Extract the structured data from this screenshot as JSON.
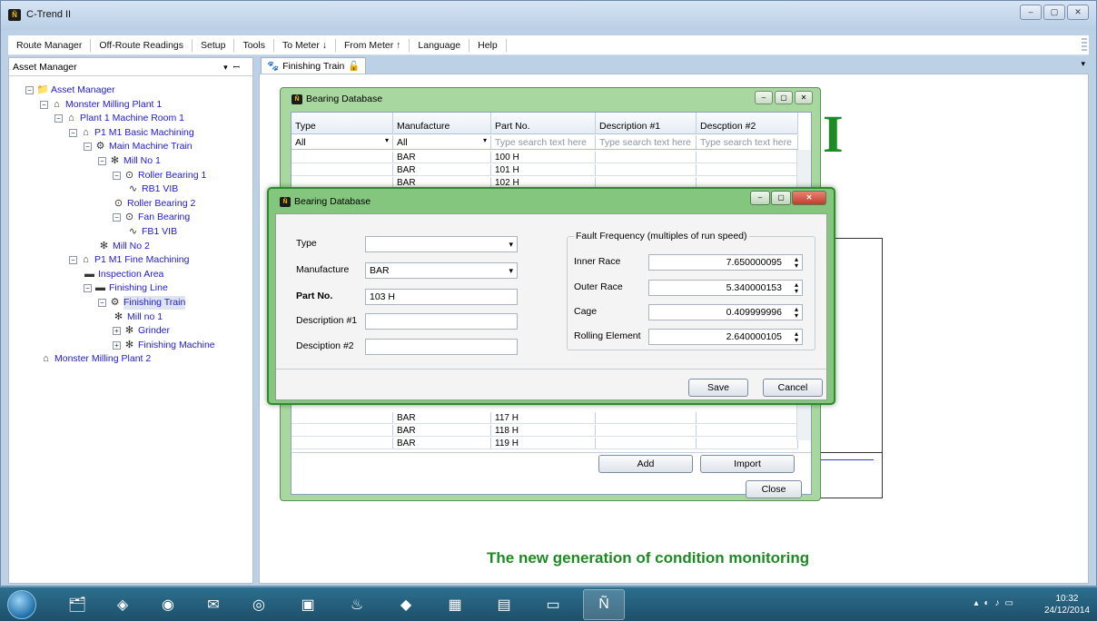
{
  "window": {
    "title": "C-Trend II",
    "controls": [
      "–",
      "▢",
      "✕"
    ]
  },
  "menu": [
    "Route Manager",
    "Off-Route Readings",
    "Setup",
    "Tools",
    "To Meter ↓",
    "From Meter ↑",
    "Language",
    "Help"
  ],
  "asset_manager": {
    "header": "Asset Manager",
    "tree": [
      {
        "label": "Asset Manager",
        "icon": "folder-icon",
        "exp": "−"
      },
      {
        "label": "Monster Milling Plant 1",
        "icon": "plant-icon",
        "exp": "−"
      },
      {
        "label": "Plant 1 Machine Room 1",
        "icon": "plant-icon",
        "exp": "−"
      },
      {
        "label": "P1 M1 Basic Machining",
        "icon": "area-icon",
        "exp": "−"
      },
      {
        "label": "Main Machine Train",
        "icon": "train-icon",
        "exp": "−"
      },
      {
        "label": "Mill No 1",
        "icon": "machine-icon",
        "exp": "−"
      },
      {
        "label": "Roller Bearing 1",
        "icon": "bearing-icon",
        "exp": "−"
      },
      {
        "label": "RB1 VIB",
        "icon": "vibration-icon",
        "exp": ""
      },
      {
        "label": "Roller Bearing 2",
        "icon": "bearing-icon",
        "exp": ""
      },
      {
        "label": "Fan Bearing",
        "icon": "bearing-icon",
        "exp": "−"
      },
      {
        "label": "FB1 VIB",
        "icon": "vibration-icon",
        "exp": ""
      },
      {
        "label": "Mill No 2",
        "icon": "machine-icon",
        "exp": ""
      },
      {
        "label": "P1 M1 Fine Machining",
        "icon": "area-icon",
        "exp": "−"
      },
      {
        "label": "Inspection Area",
        "icon": "line-icon",
        "exp": ""
      },
      {
        "label": "Finishing Line",
        "icon": "line-icon",
        "exp": "−"
      },
      {
        "label": "Finishing Train",
        "icon": "train-icon",
        "exp": "−"
      },
      {
        "label": "Mill no 1",
        "icon": "machine-icon",
        "exp": ""
      },
      {
        "label": "Grinder",
        "icon": "machine-icon",
        "exp": "+"
      },
      {
        "label": "Finishing Machine",
        "icon": "machine-icon",
        "exp": "+"
      },
      {
        "label": "Monster Milling Plant 2",
        "icon": "plant-icon",
        "exp": ""
      }
    ]
  },
  "document_tab": {
    "label": "Finishing Train"
  },
  "tagline": "The new generation of condition monitoring",
  "logo_letter": "I",
  "bearing_db": {
    "title": "Bearing Database",
    "columns": [
      "Type",
      "Manufacture",
      "Part No.",
      "Description #1",
      "Descption #2"
    ],
    "filters": [
      "All",
      "All",
      "Type search text here",
      "Type search text here",
      "Type search text here"
    ],
    "rows_top": [
      [
        "",
        "BAR",
        "100 H",
        "",
        ""
      ],
      [
        "",
        "BAR",
        "101 H",
        "",
        ""
      ],
      [
        "",
        "BAR",
        "102 H",
        "",
        ""
      ]
    ],
    "rows_bottom": [
      [
        "",
        "BAR",
        "117 H",
        "",
        ""
      ],
      [
        "",
        "BAR",
        "118 H",
        "",
        ""
      ],
      [
        "",
        "BAR",
        "119 H",
        "",
        ""
      ]
    ],
    "buttons": {
      "add": "Add",
      "import": "Import",
      "close": "Close"
    }
  },
  "dialog": {
    "title": "Bearing Database",
    "type_label": "Type",
    "type_value": "",
    "manufacture_label": "Manufacture",
    "manufacture_value": "BAR",
    "part_label": "Part No.",
    "part_value": "103 H",
    "desc1_label": "Description #1",
    "desc1_value": "",
    "desc2_label": "Desciption #2",
    "desc2_value": "",
    "ff_title": "Fault Frequency (multiples of run speed)",
    "inner_label": "Inner Race",
    "inner_value": "7.650000095",
    "outer_label": "Outer Race",
    "outer_value": "5.340000153",
    "cage_label": "Cage",
    "cage_value": "0.409999996",
    "rolling_label": "Rolling Element",
    "rolling_value": "2.640000105",
    "save": "Save",
    "cancel": "Cancel"
  },
  "taskbar": {
    "clock_time": "10:32",
    "clock_date": "24/12/2014"
  }
}
